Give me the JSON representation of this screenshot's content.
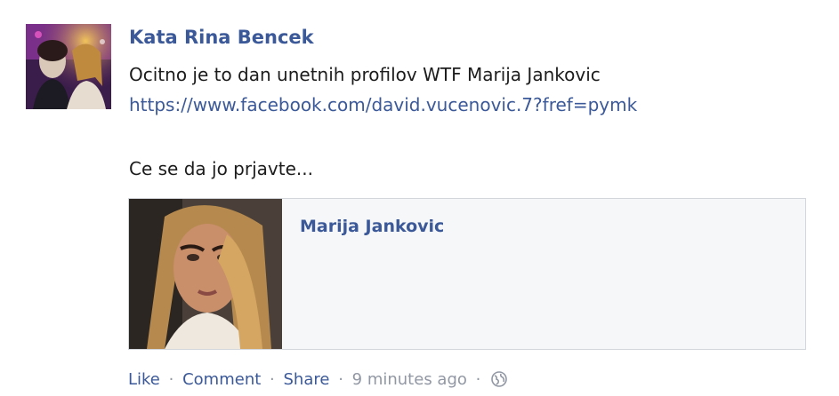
{
  "post": {
    "author": "Kata Rina Bencek",
    "text_line1": "Ocitno je to dan unetnih profilov WTF Marija Jankovic",
    "link": "https://www.facebook.com/david.vucenovic.7?fref=pymk",
    "text_line3": "Ce se da jo prjavte..."
  },
  "shared": {
    "name": "Marija Jankovic"
  },
  "actions": {
    "like": "Like",
    "comment": "Comment",
    "share": "Share",
    "separator": "·",
    "timestamp": "9 minutes ago",
    "privacy_icon": "globe-icon"
  },
  "colors": {
    "link_blue": "#3b5998",
    "meta_gray": "#9197a3",
    "card_bg": "#f6f7f8",
    "card_border": "#d3d6db"
  }
}
